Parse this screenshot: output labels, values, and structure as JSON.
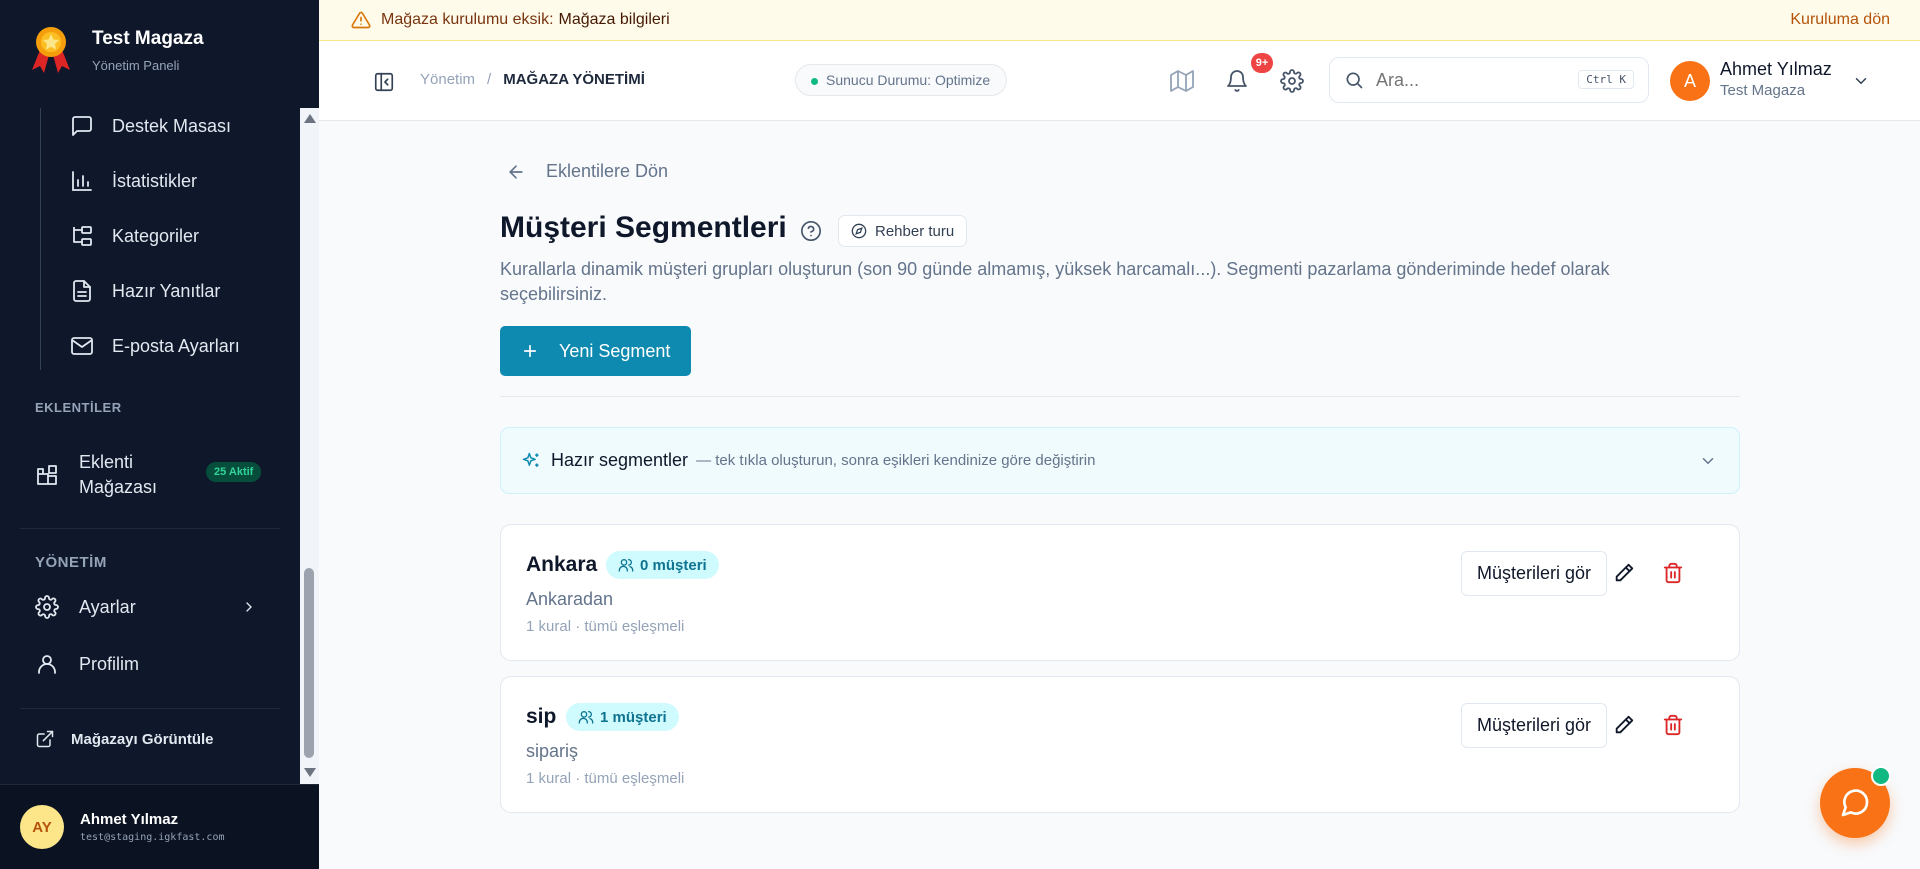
{
  "brand": {
    "title": "Test Magaza",
    "subtitle": "Yönetim Paneli"
  },
  "sidebar": {
    "sub_items": [
      {
        "label": "Destek Masası",
        "icon": "message-square-icon"
      },
      {
        "label": "İstatistikler",
        "icon": "bar-chart-icon"
      },
      {
        "label": "Kategoriler",
        "icon": "folder-tree-icon"
      },
      {
        "label": "Hazır Yanıtlar",
        "icon": "file-text-icon"
      },
      {
        "label": "E-posta Ayarları",
        "icon": "mail-icon"
      }
    ],
    "section_plugins": "EKLENTİLER",
    "plugin_store": {
      "label_line1": "Eklenti",
      "label_line2": "Mağazası",
      "badge": "25 Aktif"
    },
    "section_admin": "YÖNETİM",
    "settings": "Ayarlar",
    "profile": "Profilim",
    "view_store": "Mağazayı Görüntüle"
  },
  "footer_user": {
    "initials": "AY",
    "name": "Ahmet Yılmaz",
    "email": "test@staging.igkfast.com"
  },
  "banner": {
    "prefix": "Mağaza kurulumu eksik:",
    "item": "Mağaza bilgileri",
    "link": "Kuruluma dön"
  },
  "topbar": {
    "breadcrumb_root": "Yönetim",
    "breadcrumb_sep": "/",
    "breadcrumb_current": "MAĞAZA YÖNETİMİ",
    "server_status": "Sunucu Durumu: Optimize",
    "notifications_badge": "9+",
    "search_placeholder": "Ara...",
    "search_shortcut": "Ctrl K",
    "user_initial": "A",
    "user_name": "Ahmet Yılmaz",
    "user_store": "Test Magaza"
  },
  "page": {
    "back_label": "Eklentilere Dön",
    "title": "Müşteri Segmentleri",
    "tour_label": "Rehber turu",
    "description": "Kurallarla dinamik müşteri grupları oluşturun (son 90 günde almamış, yüksek harcamalı...). Segmenti pazarlama gönderiminde hedef olarak seçebilirsiniz.",
    "new_button": "Yeni Segment",
    "preset_title": "Hazır segmentler",
    "preset_hint": "— tek tıkla oluşturun, sonra eşikleri kendinize göre değiştirin"
  },
  "segments": [
    {
      "name": "Ankara",
      "count": "0 müşteri",
      "description": "Ankaradan",
      "meta": "1 kural · tümü eşleşmeli",
      "view_button": "Müşterileri gör"
    },
    {
      "name": "sip",
      "count": "1 müşteri",
      "description": "sipariş",
      "meta": "1 kural · tümü eşleşmeli",
      "view_button": "Müşterileri gör"
    }
  ],
  "colors": {
    "sidebar_bg": "#0f172a",
    "primary": "#0e8ab0",
    "accent_orange": "#f97316",
    "danger": "#dc2626",
    "banner_bg": "#fffbeb"
  }
}
